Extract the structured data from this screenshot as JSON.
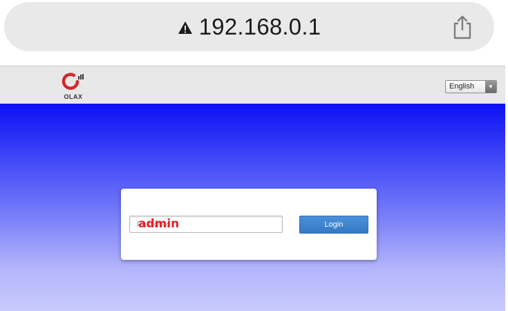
{
  "browser": {
    "url": "192.168.0.1",
    "warning_icon": "warning-triangle-icon",
    "share_icon": "share-icon"
  },
  "header": {
    "logo_text": "OLAX",
    "language": {
      "selected": "English",
      "arrow": "▼"
    }
  },
  "login": {
    "password_placeholder": "Password",
    "password_value": "admin",
    "button_label": "Login"
  },
  "colors": {
    "hero_top": "#0b10f4",
    "hero_bottom": "#c8cafc",
    "login_button": "#3d84cf",
    "logo_red": "#d7262b",
    "entered_text": "#e0222b"
  }
}
